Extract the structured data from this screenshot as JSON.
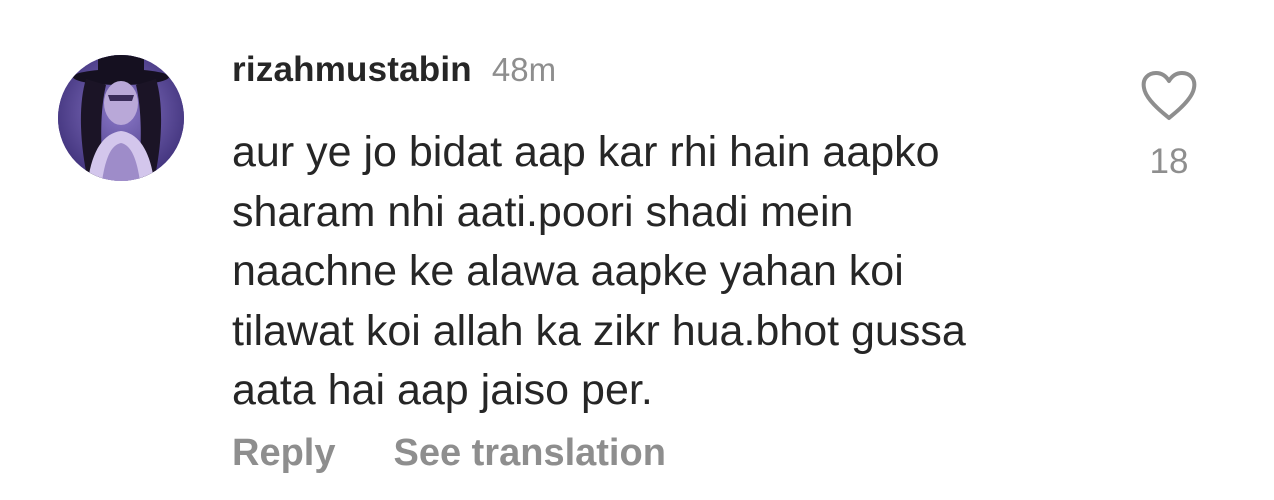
{
  "comment": {
    "username": "rizahmustabin",
    "timestamp": "48m",
    "text_lines": [
      "aur ye jo bidat aap kar rhi hain aapko",
      "sharam nhi aati.poori shadi mein",
      "naachne ke alawa aapke yahan koi",
      "tilawat koi allah ka zikr hua.bhot gussa",
      "aata hai aap jaiso per."
    ],
    "like_count": "18",
    "reply_label": "Reply",
    "translate_label": "See translation",
    "avatar_icon": "profile-avatar",
    "like_icon": "heart-outline-icon"
  },
  "colors": {
    "text_primary": "#262626",
    "text_secondary": "#8e8e8e",
    "background": "#ffffff"
  }
}
